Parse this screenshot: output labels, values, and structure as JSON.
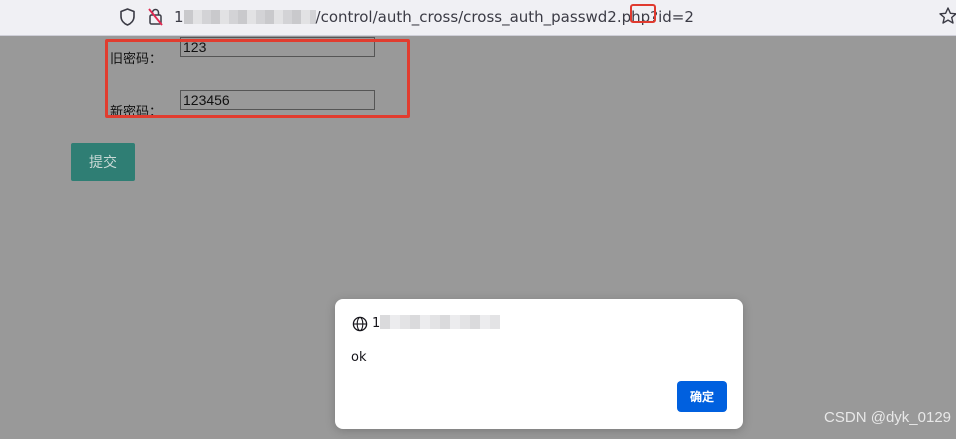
{
  "browser": {
    "url_host_start": "1",
    "url_path": "/control/auth_cross/cross_auth_passwd2.php?id=",
    "url_id": "2",
    "icons": [
      "shield-icon",
      "blocked-lock-icon",
      "bookmark-star-icon"
    ]
  },
  "form": {
    "old_password_label": "旧密码：",
    "old_password_value": "123",
    "new_password_label": "新密码：",
    "new_password_value": "123456",
    "submit_label": "提交",
    "highlight_color": "#e13c2f"
  },
  "dialog": {
    "host_start": "1",
    "message": "ok",
    "ok_label": "确定",
    "icon": "globe-icon",
    "button_color": "#0060df"
  },
  "watermark": "CSDN @dyk_0129"
}
